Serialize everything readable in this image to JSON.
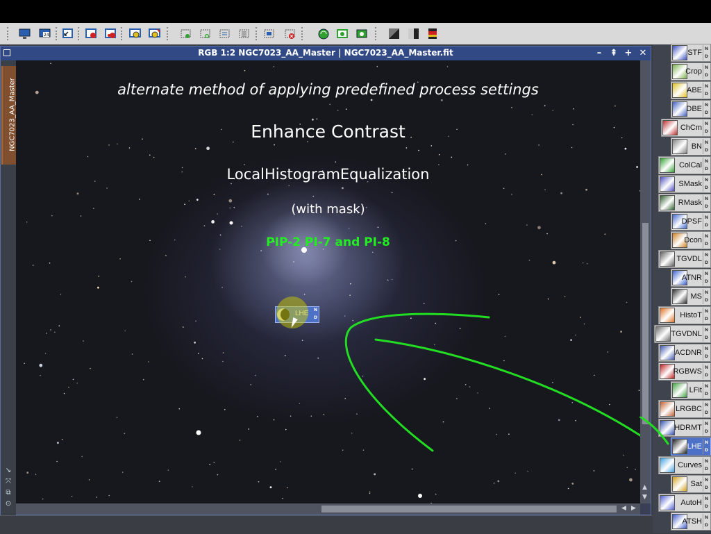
{
  "window": {
    "title": "RGB 1:2 NGC7023_AA_Master | NGC7023_AA_Master.fit",
    "side_tab": "NGC7023_AA_Master",
    "controls": [
      "–",
      "⇞",
      "+",
      "✕"
    ]
  },
  "image_text": {
    "subtitle": "alternate method of applying predefined process settings",
    "heading": "Enhance Contrast",
    "process": "LocalHistogramEqualization",
    "note": "(with mask)",
    "versions": "PIP-2 PI-7 and PI-8",
    "versions_color": "#22ee22"
  },
  "drag_icon": {
    "label": "LHE",
    "n": "N",
    "d": "D"
  },
  "annotation_color": "#22dd22",
  "process_icons": [
    {
      "label": "STF",
      "icon": "stf-icon",
      "color": "#3a50c0"
    },
    {
      "label": "Crop",
      "icon": "crop-icon",
      "color": "#7ab048"
    },
    {
      "label": "ABE",
      "icon": "abe-icon",
      "color": "#e0c020"
    },
    {
      "label": "DBE",
      "icon": "dbe-icon",
      "color": "#4060c0"
    },
    {
      "label": "ChCm",
      "icon": "chcm-icon",
      "color": "#c03030"
    },
    {
      "label": "BN",
      "icon": "bn-icon",
      "color": "#808080"
    },
    {
      "label": "ColCal",
      "icon": "colcal-icon",
      "color": "#30a030"
    },
    {
      "label": "SMask",
      "icon": "smask-icon",
      "color": "#5050c0"
    },
    {
      "label": "RMask",
      "icon": "rmask-icon",
      "color": "#306030"
    },
    {
      "label": "DPSF",
      "icon": "dpsf-icon",
      "color": "#4068d0"
    },
    {
      "label": "Dcon",
      "icon": "dcon-icon",
      "color": "#d08020"
    },
    {
      "label": "TGVDL",
      "icon": "tgvdl-icon",
      "color": "#606060"
    },
    {
      "label": "ATNR",
      "icon": "atnr-icon",
      "color": "#3a60d0"
    },
    {
      "label": "MS",
      "icon": "ms-icon",
      "color": "#303030"
    },
    {
      "label": "HistoT",
      "icon": "histot-icon",
      "color": "#e07020"
    },
    {
      "label": "TGVDNL",
      "icon": "tgvdnl-icon",
      "color": "#707070"
    },
    {
      "label": "ACDNR",
      "icon": "acdnr-icon",
      "color": "#4058b0"
    },
    {
      "label": "RGBWS",
      "icon": "rgbws-icon",
      "color": "#c02020"
    },
    {
      "label": "LFit",
      "icon": "lfit-icon",
      "color": "#40a040"
    },
    {
      "label": "LRGBC",
      "icon": "lrgbc-icon",
      "color": "#c06030"
    },
    {
      "label": "HDRMT",
      "icon": "hdrmt-icon",
      "color": "#3050b0"
    },
    {
      "label": "LHE",
      "icon": "lhe-icon",
      "color": "#202020",
      "active": true
    },
    {
      "label": "Curves",
      "icon": "curves-icon",
      "color": "#40a0e0"
    },
    {
      "label": "Sat",
      "icon": "sat-icon",
      "color": "#d0a020"
    },
    {
      "label": "AutoH",
      "icon": "autoh-icon",
      "color": "#5060d0"
    },
    {
      "label": "ATSH",
      "icon": "atsh-icon",
      "color": "#3a58c8"
    }
  ],
  "panel_nd": {
    "n": "N",
    "d": "D"
  }
}
